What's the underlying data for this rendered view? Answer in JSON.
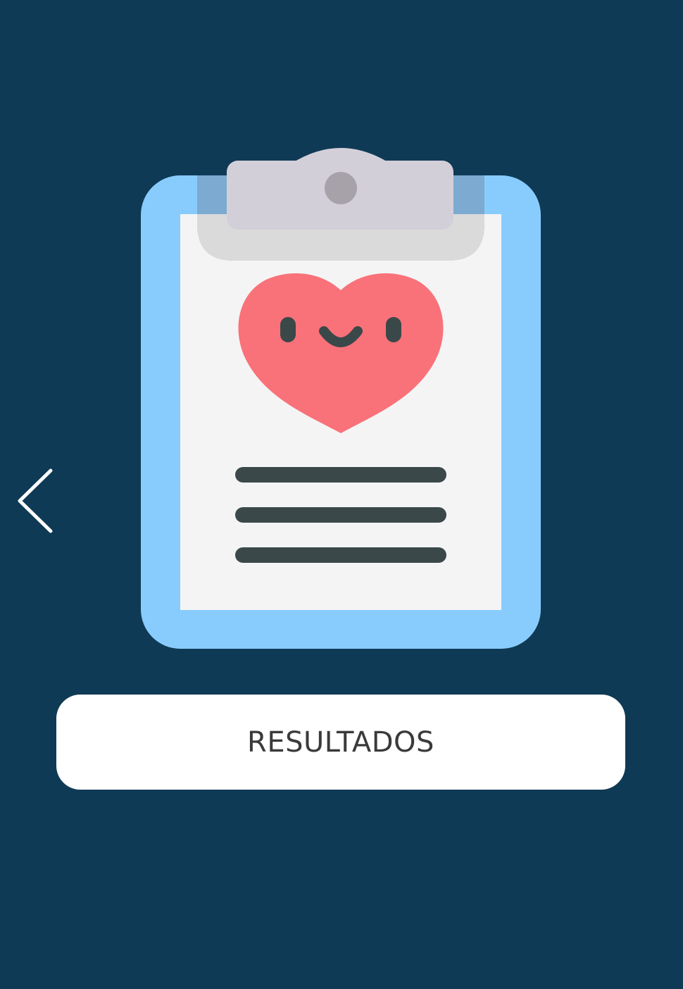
{
  "screen": {
    "background": "#0f3a55"
  },
  "nav": {
    "back_icon": "chevron-left-icon"
  },
  "illustration": {
    "icon": "clipboard-heart-icon",
    "colors": {
      "board": "#88ccfd",
      "paper": "#f4f4f5",
      "clip": "#d3cfd9",
      "heart": "#f97279",
      "lines": "#3a4849"
    }
  },
  "actions": {
    "results_label": "RESULTADOS"
  }
}
